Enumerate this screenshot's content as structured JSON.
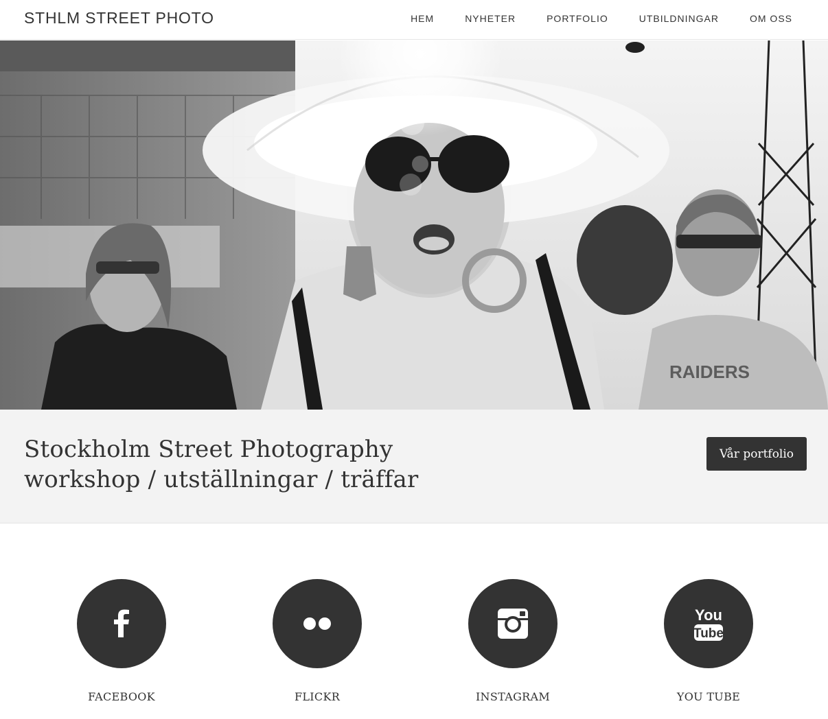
{
  "site": {
    "title": "STHLM STREET PHOTO"
  },
  "nav": [
    {
      "label": "HEM"
    },
    {
      "label": "NYHETER"
    },
    {
      "label": "PORTFOLIO"
    },
    {
      "label": "UTBILDNINGAR"
    },
    {
      "label": "OM OSS"
    }
  ],
  "hero": {
    "image": "black-and-white street photograph of a woman in a wide sun hat and sunglasses, with a man and a woman walking behind her"
  },
  "cta": {
    "line1": "Stockholm Street Photography",
    "line2": "workshop / utställningar / träffar",
    "button": "Vår portfolio"
  },
  "social": [
    {
      "label": "FACEBOOK",
      "icon": "facebook-icon"
    },
    {
      "label": "FLICKR",
      "icon": "flickr-icon"
    },
    {
      "label": "INSTAGRAM",
      "icon": "instagram-icon"
    },
    {
      "label": "YOU TUBE",
      "icon": "youtube-icon"
    }
  ],
  "colors": {
    "dark": "#333333",
    "band": "#f3f3f3"
  }
}
